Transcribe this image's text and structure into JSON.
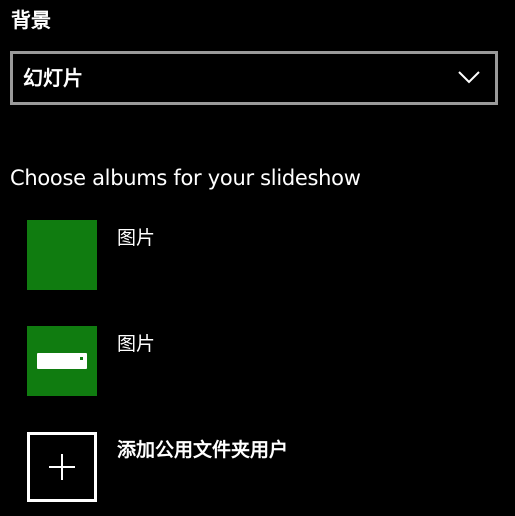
{
  "background": {
    "heading": "背景",
    "dropdown": {
      "selected": "幻灯片",
      "icon": "chevron-down-icon"
    }
  },
  "slideshow": {
    "heading": "Choose albums for your slideshow",
    "albums": [
      {
        "label": "图片",
        "icon": "none",
        "thumb_color": "#107c10"
      },
      {
        "label": "图片",
        "icon": "drive-icon",
        "thumb_color": "#107c10"
      }
    ],
    "add_folder": {
      "label": "添加公用文件夹用户",
      "icon": "plus-icon"
    }
  },
  "colors": {
    "background": "#000000",
    "accent": "#107c10",
    "border": "#9a9a9a",
    "text": "#ffffff"
  }
}
